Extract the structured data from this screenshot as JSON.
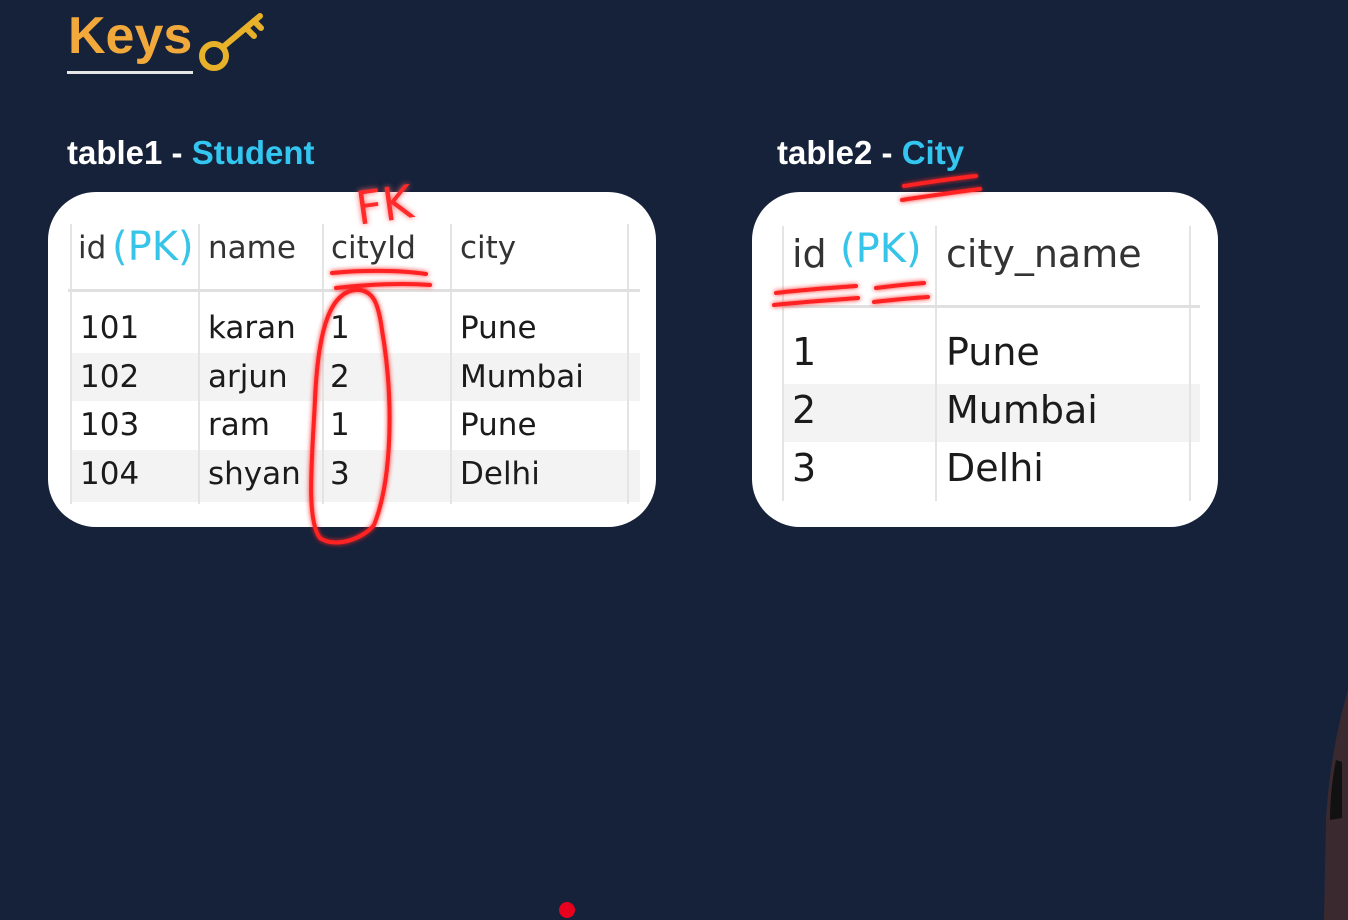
{
  "header": {
    "title": "Keys"
  },
  "table1": {
    "label_prefix": "table1 - ",
    "label_name": "Student",
    "columns": [
      "id",
      "name",
      "cityId",
      "city"
    ],
    "pk_note": "(PK)",
    "fk_note": "FK",
    "rows": [
      [
        "101",
        "karan",
        "1",
        "Pune"
      ],
      [
        "102",
        "arjun",
        "2",
        "Mumbai"
      ],
      [
        "103",
        "ram",
        "1",
        "Pune"
      ],
      [
        "104",
        "shyan",
        "3",
        "Delhi"
      ]
    ]
  },
  "table2": {
    "label_prefix": "table2 - ",
    "label_name": "City",
    "columns": [
      "id",
      "city_name"
    ],
    "pk_note": "(PK)",
    "rows": [
      [
        "1",
        "Pune"
      ],
      [
        "2",
        "Mumbai"
      ],
      [
        "3",
        "Delhi"
      ]
    ]
  },
  "colors": {
    "background": "#15223a",
    "title": "#f2a93b",
    "accent": "#33c6f0",
    "annotation": "#ff2a2a"
  }
}
